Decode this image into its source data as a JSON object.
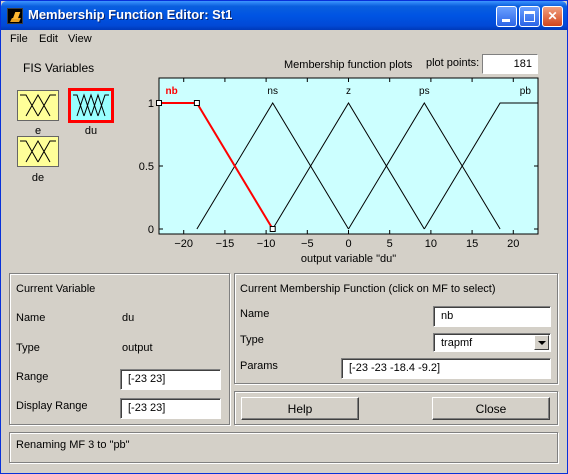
{
  "window": {
    "title": "Membership Function Editor: St1",
    "title_color": "#0054e3"
  },
  "menu": {
    "items": [
      "File",
      "Edit",
      "View"
    ]
  },
  "fis_variables": {
    "label": "FIS Variables",
    "inputs": [
      {
        "name": "e"
      },
      {
        "name": "de"
      }
    ],
    "outputs": [
      {
        "name": "du",
        "selected": true
      }
    ],
    "input_color": "#ffff99",
    "output_color": "#99ffff"
  },
  "plot": {
    "title": "Membership function plots",
    "plot_points_label": "plot points:",
    "plot_points_value": "181"
  },
  "chart_data": {
    "type": "line",
    "xlabel": "output variable \"du\"",
    "xlim": [
      -23,
      23
    ],
    "ylim": [
      0,
      1
    ],
    "xticks": [
      -20,
      -15,
      -10,
      -5,
      0,
      5,
      10,
      15,
      20
    ],
    "yticks": [
      0,
      0.5,
      1
    ],
    "ytick_labels": [
      "0",
      "0.5",
      "1"
    ],
    "background": "#ccffff",
    "series": [
      {
        "name": "nb",
        "type": "trapmf",
        "selected": true,
        "color": "#ff0000",
        "x": [
          -23,
          -23,
          -18.4,
          -9.2
        ],
        "y": [
          1,
          1,
          1,
          0
        ]
      },
      {
        "name": "ns",
        "type": "trimf",
        "color": "#000000",
        "x": [
          -18.4,
          -9.2,
          0
        ],
        "y": [
          0,
          1,
          0
        ]
      },
      {
        "name": "z",
        "type": "trimf",
        "color": "#000000",
        "x": [
          -9.2,
          0,
          9.2
        ],
        "y": [
          0,
          1,
          0
        ]
      },
      {
        "name": "ps",
        "type": "trimf",
        "color": "#000000",
        "x": [
          0,
          9.2,
          18.4
        ],
        "y": [
          0,
          1,
          0
        ]
      },
      {
        "name": "pb",
        "type": "trapmf",
        "color": "#000000",
        "x": [
          9.2,
          18.4,
          23,
          23
        ],
        "y": [
          0,
          1,
          1,
          1
        ]
      }
    ]
  },
  "current_variable": {
    "header": "Current Variable",
    "name_label": "Name",
    "name_value": "du",
    "type_label": "Type",
    "type_value": "output",
    "range_label": "Range",
    "range_value": "[-23 23]",
    "display_range_label": "Display Range",
    "display_range_value": "[-23 23]"
  },
  "current_mf": {
    "header": "Current Membership Function (click on MF to select)",
    "name_label": "Name",
    "name_value": "nb",
    "type_label": "Type",
    "type_value": "trapmf",
    "params_label": "Params",
    "params_value": "[-23 -23 -18.4 -9.2]"
  },
  "buttons": {
    "help": "Help",
    "close": "Close"
  },
  "status": {
    "text": "Renaming MF 3 to \"pb\""
  }
}
